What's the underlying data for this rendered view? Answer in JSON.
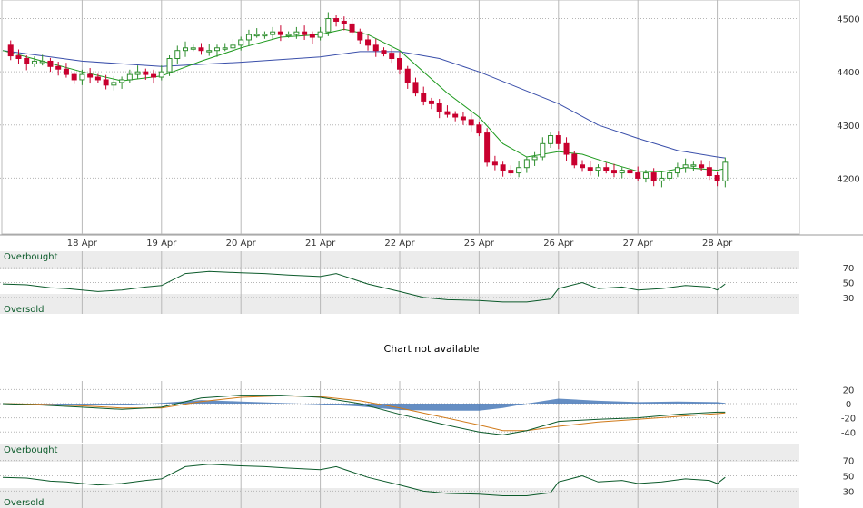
{
  "chart_data": [
    {
      "type": "candlestick",
      "panel": "price",
      "y_ticks": [
        4200,
        4300,
        4400,
        4500
      ],
      "ylim": [
        4095,
        4535
      ],
      "x_ticks": [
        "18 Apr",
        "19 Apr",
        "20 Apr",
        "21 Apr",
        "22 Apr",
        "25 Apr",
        "26 Apr",
        "27 Apr",
        "28 Apr"
      ],
      "session_count": 10,
      "grid": true,
      "colors": {
        "up": "#2f8f2f",
        "down": "#c8002f",
        "ma_short": "#1e9a1e",
        "ma_long": "#3a4faa"
      },
      "close_path": [
        [
          0.0,
          4450
        ],
        [
          0.1,
          4430
        ],
        [
          0.2,
          4425
        ],
        [
          0.3,
          4415
        ],
        [
          0.4,
          4420
        ],
        [
          0.5,
          4420
        ],
        [
          0.6,
          4410
        ],
        [
          0.7,
          4405
        ],
        [
          0.8,
          4395
        ],
        [
          0.9,
          4385
        ],
        [
          1.0,
          4395
        ],
        [
          1.1,
          4390
        ],
        [
          1.2,
          4385
        ],
        [
          1.3,
          4375
        ],
        [
          1.4,
          4380
        ],
        [
          1.5,
          4385
        ],
        [
          1.6,
          4395
        ],
        [
          1.7,
          4400
        ],
        [
          1.8,
          4395
        ],
        [
          1.9,
          4390
        ],
        [
          2.0,
          4400
        ],
        [
          2.1,
          4425
        ],
        [
          2.2,
          4440
        ],
        [
          2.3,
          4445
        ],
        [
          2.4,
          4445
        ],
        [
          2.5,
          4440
        ],
        [
          2.6,
          4440
        ],
        [
          2.7,
          4445
        ],
        [
          2.8,
          4445
        ],
        [
          2.9,
          4450
        ],
        [
          3.0,
          4460
        ],
        [
          3.1,
          4470
        ],
        [
          3.2,
          4470
        ],
        [
          3.3,
          4470
        ],
        [
          3.4,
          4475
        ],
        [
          3.5,
          4470
        ],
        [
          3.6,
          4470
        ],
        [
          3.7,
          4475
        ],
        [
          3.8,
          4470
        ],
        [
          3.9,
          4465
        ],
        [
          4.0,
          4475
        ],
        [
          4.1,
          4500
        ],
        [
          4.2,
          4495
        ],
        [
          4.3,
          4490
        ],
        [
          4.4,
          4475
        ],
        [
          4.5,
          4460
        ],
        [
          4.6,
          4450
        ],
        [
          4.7,
          4440
        ],
        [
          4.8,
          4435
        ],
        [
          4.9,
          4425
        ],
        [
          5.0,
          4405
        ],
        [
          5.1,
          4380
        ],
        [
          5.2,
          4360
        ],
        [
          5.3,
          4345
        ],
        [
          5.4,
          4340
        ],
        [
          5.5,
          4325
        ],
        [
          5.6,
          4320
        ],
        [
          5.7,
          4315
        ],
        [
          5.8,
          4310
        ],
        [
          5.9,
          4300
        ],
        [
          6.0,
          4285
        ],
        [
          6.1,
          4230
        ],
        [
          6.2,
          4225
        ],
        [
          6.3,
          4215
        ],
        [
          6.4,
          4210
        ],
        [
          6.5,
          4220
        ],
        [
          6.6,
          4235
        ],
        [
          6.7,
          4240
        ],
        [
          6.8,
          4265
        ],
        [
          6.9,
          4280
        ],
        [
          7.0,
          4265
        ],
        [
          7.1,
          4245
        ],
        [
          7.2,
          4225
        ],
        [
          7.3,
          4220
        ],
        [
          7.4,
          4215
        ],
        [
          7.5,
          4220
        ],
        [
          7.6,
          4215
        ],
        [
          7.7,
          4210
        ],
        [
          7.8,
          4215
        ],
        [
          7.9,
          4210
        ],
        [
          8.0,
          4200
        ],
        [
          8.1,
          4210
        ],
        [
          8.2,
          4195
        ],
        [
          8.3,
          4200
        ],
        [
          8.4,
          4210
        ],
        [
          8.5,
          4220
        ],
        [
          8.6,
          4225
        ],
        [
          8.7,
          4225
        ],
        [
          8.8,
          4220
        ],
        [
          8.9,
          4205
        ],
        [
          9.0,
          4195
        ],
        [
          9.1,
          4230
        ]
      ],
      "ma_short_path": [
        [
          0.0,
          4440
        ],
        [
          0.5,
          4420
        ],
        [
          1.0,
          4400
        ],
        [
          1.5,
          4383
        ],
        [
          2.0,
          4392
        ],
        [
          2.5,
          4420
        ],
        [
          3.0,
          4445
        ],
        [
          3.5,
          4465
        ],
        [
          4.0,
          4470
        ],
        [
          4.3,
          4480
        ],
        [
          4.6,
          4470
        ],
        [
          5.0,
          4440
        ],
        [
          5.3,
          4400
        ],
        [
          5.6,
          4360
        ],
        [
          6.0,
          4315
        ],
        [
          6.3,
          4265
        ],
        [
          6.6,
          4240
        ],
        [
          7.0,
          4250
        ],
        [
          7.3,
          4245
        ],
        [
          7.6,
          4230
        ],
        [
          8.0,
          4213
        ],
        [
          8.3,
          4212
        ],
        [
          8.6,
          4220
        ],
        [
          9.0,
          4215
        ],
        [
          9.1,
          4218
        ]
      ],
      "ma_long_path": [
        [
          0.0,
          4440
        ],
        [
          1.0,
          4420
        ],
        [
          2.0,
          4410
        ],
        [
          3.0,
          4418
        ],
        [
          4.0,
          4428
        ],
        [
          4.5,
          4438
        ],
        [
          5.0,
          4438
        ],
        [
          5.5,
          4425
        ],
        [
          6.0,
          4400
        ],
        [
          6.5,
          4370
        ],
        [
          7.0,
          4340
        ],
        [
          7.5,
          4300
        ],
        [
          8.0,
          4275
        ],
        [
          8.5,
          4252
        ],
        [
          9.0,
          4240
        ],
        [
          9.1,
          4238
        ]
      ]
    },
    {
      "type": "line",
      "panel": "rsi",
      "y_ticks": [
        30,
        50,
        70
      ],
      "ylim": [
        8,
        92
      ],
      "labels": {
        "overbought": "Overbought",
        "oversold": "Oversold"
      },
      "color": "#0b5a2a",
      "values": [
        [
          0.0,
          48
        ],
        [
          0.3,
          47
        ],
        [
          0.6,
          43
        ],
        [
          0.8,
          42
        ],
        [
          1.0,
          40
        ],
        [
          1.2,
          38
        ],
        [
          1.5,
          40
        ],
        [
          1.8,
          44
        ],
        [
          2.0,
          46
        ],
        [
          2.3,
          62
        ],
        [
          2.6,
          65
        ],
        [
          3.0,
          63
        ],
        [
          3.3,
          62
        ],
        [
          3.6,
          60
        ],
        [
          4.0,
          58
        ],
        [
          4.2,
          62
        ],
        [
          4.6,
          48
        ],
        [
          5.0,
          38
        ],
        [
          5.3,
          30
        ],
        [
          5.6,
          27
        ],
        [
          6.0,
          26
        ],
        [
          6.3,
          24
        ],
        [
          6.6,
          24
        ],
        [
          6.9,
          28
        ],
        [
          7.0,
          42
        ],
        [
          7.3,
          50
        ],
        [
          7.5,
          42
        ],
        [
          7.8,
          44
        ],
        [
          8.0,
          40
        ],
        [
          8.3,
          42
        ],
        [
          8.6,
          46
        ],
        [
          8.9,
          44
        ],
        [
          9.0,
          40
        ],
        [
          9.1,
          48
        ]
      ]
    },
    {
      "type": "message",
      "panel": "placeholder",
      "text": "Chart not available"
    },
    {
      "type": "macd",
      "panel": "macd",
      "y_ticks": [
        -40,
        -20,
        0,
        20
      ],
      "ylim": [
        -55,
        32
      ],
      "colors": {
        "macd": "#0b5a2a",
        "signal": "#d07a1a",
        "histogram": "#4a7ab8"
      },
      "macd_line": [
        [
          0.0,
          0
        ],
        [
          0.5,
          -2
        ],
        [
          1.0,
          -5
        ],
        [
          1.5,
          -8
        ],
        [
          2.0,
          -5
        ],
        [
          2.5,
          8
        ],
        [
          3.0,
          12
        ],
        [
          3.5,
          12
        ],
        [
          4.0,
          9
        ],
        [
          4.5,
          0
        ],
        [
          5.0,
          -15
        ],
        [
          5.5,
          -28
        ],
        [
          6.0,
          -40
        ],
        [
          6.3,
          -44
        ],
        [
          6.6,
          -38
        ],
        [
          7.0,
          -25
        ],
        [
          7.5,
          -22
        ],
        [
          8.0,
          -20
        ],
        [
          8.5,
          -15
        ],
        [
          9.0,
          -12
        ],
        [
          9.1,
          -12
        ]
      ],
      "signal_line": [
        [
          0.0,
          0
        ],
        [
          0.5,
          -1
        ],
        [
          1.0,
          -3
        ],
        [
          1.5,
          -6
        ],
        [
          2.0,
          -6
        ],
        [
          2.5,
          3
        ],
        [
          3.0,
          9
        ],
        [
          3.5,
          11
        ],
        [
          4.0,
          10
        ],
        [
          4.5,
          4
        ],
        [
          5.0,
          -6
        ],
        [
          5.5,
          -18
        ],
        [
          6.0,
          -30
        ],
        [
          6.3,
          -38
        ],
        [
          6.6,
          -38
        ],
        [
          7.0,
          -32
        ],
        [
          7.5,
          -26
        ],
        [
          8.0,
          -22
        ],
        [
          8.5,
          -18
        ],
        [
          9.0,
          -14
        ],
        [
          9.1,
          -13
        ]
      ],
      "histogram": [
        [
          0.0,
          0
        ],
        [
          0.5,
          -1
        ],
        [
          1.0,
          -2
        ],
        [
          1.5,
          -2
        ],
        [
          2.0,
          1
        ],
        [
          2.5,
          5
        ],
        [
          3.0,
          3
        ],
        [
          3.5,
          1
        ],
        [
          4.0,
          -1
        ],
        [
          4.5,
          -4
        ],
        [
          5.0,
          -9
        ],
        [
          5.5,
          -10
        ],
        [
          6.0,
          -10
        ],
        [
          6.3,
          -6
        ],
        [
          6.6,
          0
        ],
        [
          7.0,
          7
        ],
        [
          7.5,
          4
        ],
        [
          8.0,
          2
        ],
        [
          8.5,
          3
        ],
        [
          9.0,
          2
        ],
        [
          9.1,
          1
        ]
      ]
    },
    {
      "type": "line",
      "panel": "stochastic",
      "y_ticks": [
        30,
        50,
        70
      ],
      "ylim": [
        8,
        92
      ],
      "labels": {
        "overbought": "Overbought",
        "oversold": "Oversold"
      },
      "color": "#0b5a2a",
      "values": [
        [
          0.0,
          48
        ],
        [
          0.3,
          47
        ],
        [
          0.6,
          43
        ],
        [
          0.8,
          42
        ],
        [
          1.0,
          40
        ],
        [
          1.2,
          38
        ],
        [
          1.5,
          40
        ],
        [
          1.8,
          44
        ],
        [
          2.0,
          46
        ],
        [
          2.3,
          62
        ],
        [
          2.6,
          65
        ],
        [
          3.0,
          63
        ],
        [
          3.3,
          62
        ],
        [
          3.6,
          60
        ],
        [
          4.0,
          58
        ],
        [
          4.2,
          62
        ],
        [
          4.6,
          48
        ],
        [
          5.0,
          38
        ],
        [
          5.3,
          30
        ],
        [
          5.6,
          27
        ],
        [
          6.0,
          26
        ],
        [
          6.3,
          24
        ],
        [
          6.6,
          24
        ],
        [
          6.9,
          28
        ],
        [
          7.0,
          42
        ],
        [
          7.3,
          50
        ],
        [
          7.5,
          42
        ],
        [
          7.8,
          44
        ],
        [
          8.0,
          40
        ],
        [
          8.3,
          42
        ],
        [
          8.6,
          46
        ],
        [
          8.9,
          44
        ],
        [
          9.0,
          40
        ],
        [
          9.1,
          48
        ]
      ]
    }
  ]
}
